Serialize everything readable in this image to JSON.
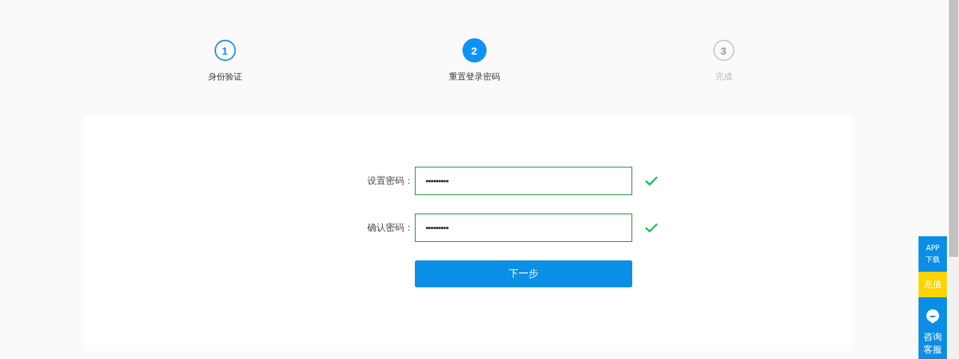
{
  "steps": [
    {
      "number": "1",
      "label": "身份验证",
      "completed": true,
      "selected": false
    },
    {
      "number": "2",
      "label": "重置登录密码",
      "completed": false,
      "selected": true
    },
    {
      "number": "3",
      "label": "完成",
      "completed": false,
      "selected": false
    }
  ],
  "fields": [
    {
      "label": "设置密码：",
      "value": "•••••••••",
      "valid": true
    },
    {
      "label": "确认密码：",
      "value": "•••••••••",
      "valid": true
    }
  ],
  "submit_button": "下一步",
  "side_bar": [
    {
      "kind": "app",
      "lines": [
        "APP",
        "下载"
      ]
    },
    {
      "kind": "recharge",
      "lines": [
        "充值"
      ]
    },
    {
      "kind": "service",
      "lines": [
        "咨询",
        "客服"
      ]
    }
  ]
}
